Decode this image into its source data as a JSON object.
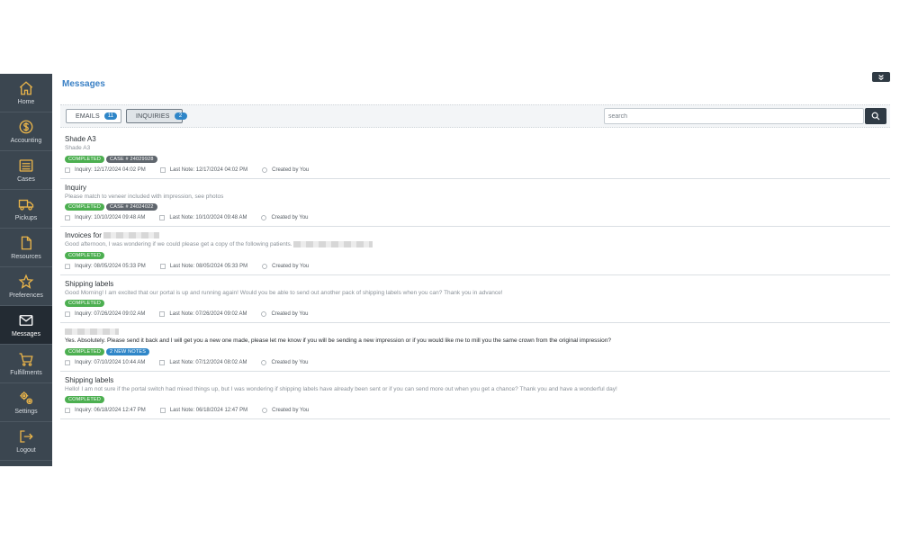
{
  "page_title": "Messages",
  "sidebar": {
    "items": [
      {
        "label": "Home",
        "icon": "home-icon"
      },
      {
        "label": "Accounting",
        "icon": "dollar-icon"
      },
      {
        "label": "Cases",
        "icon": "list-icon"
      },
      {
        "label": "Pickups",
        "icon": "truck-icon"
      },
      {
        "label": "Resources",
        "icon": "file-icon"
      },
      {
        "label": "Preferences",
        "icon": "star-icon"
      },
      {
        "label": "Messages",
        "icon": "envelope-icon"
      },
      {
        "label": "Fulfillments",
        "icon": "cart-icon"
      },
      {
        "label": "Settings",
        "icon": "gears-icon"
      },
      {
        "label": "Logout",
        "icon": "logout-icon"
      }
    ],
    "active": "Messages"
  },
  "toolbar": {
    "tabs": [
      {
        "label": "EMAILS",
        "count": "11"
      },
      {
        "label": "INQUIRIES",
        "count": "2"
      }
    ],
    "search": {
      "placeholder": "search",
      "value": ""
    }
  },
  "messages": [
    {
      "title": "Shade A3",
      "preview": "Shade A3",
      "tags": [
        "COMPLETED",
        "CASE # 24029928"
      ],
      "inquiry": "Inquiry: 12/17/2024 04:02 PM",
      "last_note": "Last Note: 12/17/2024 04:02 PM",
      "created_by": "Created by You"
    },
    {
      "title": "Inquiry",
      "preview": "Please match to veneer included with impression, see photos",
      "tags": [
        "COMPLETED",
        "CASE # 24024022"
      ],
      "inquiry": "Inquiry: 10/10/2024 09:48 AM",
      "last_note": "Last Note: 10/10/2024 09:48 AM",
      "created_by": "Created by You"
    },
    {
      "title": "Invoices for",
      "preview": "Good afternoon, I was wondering if we could please get a copy of the following patients.",
      "tags": [
        "COMPLETED"
      ],
      "inquiry": "Inquiry: 08/05/2024 05:33 PM",
      "last_note": "Last Note: 08/05/2024 05:33 PM",
      "created_by": "Created by You"
    },
    {
      "title": "Shipping labels",
      "preview": "Good Morning! I am excited that our portal is up and running again! Would you be able to send out another pack of shipping labels when you can? Thank you in advance!",
      "tags": [
        "COMPLETED"
      ],
      "inquiry": "Inquiry: 07/26/2024 09:02 AM",
      "last_note": "Last Note: 07/26/2024 09:02 AM",
      "created_by": "Created by You"
    },
    {
      "title": "",
      "preview": "Yes. Absolutely. Please send it back and I will get you a new one made, please let me know if you will be sending a new impression or if you would like me to mill you the same crown from the original impression?",
      "tags": [
        "COMPLETED",
        "2 NEW NOTES"
      ],
      "inquiry": "Inquiry: 07/10/2024 10:44 AM",
      "last_note": "Last Note: 07/12/2024 08:02 AM",
      "created_by": "Created by You"
    },
    {
      "title": "Shipping labels",
      "preview": "Hello! I am not sure if the portal switch had mixed things up, but I was wondering if shipping labels have already been sent or if you can send more out when you get a chance? Thank you and have a wonderful day!",
      "tags": [
        "COMPLETED"
      ],
      "inquiry": "Inquiry: 06/18/2024 12:47 PM",
      "last_note": "Last Note: 06/18/2024 12:47 PM",
      "created_by": "Created by You"
    }
  ],
  "colors": {
    "sidebar_bg": "#3b4650",
    "sidebar_active": "#232b33",
    "icon_accent": "#e9b44a",
    "title_blue": "#3a80c5",
    "badge_blue": "#2f86c8",
    "completed_green": "#4caf50",
    "case_gray": "#5f666d"
  }
}
